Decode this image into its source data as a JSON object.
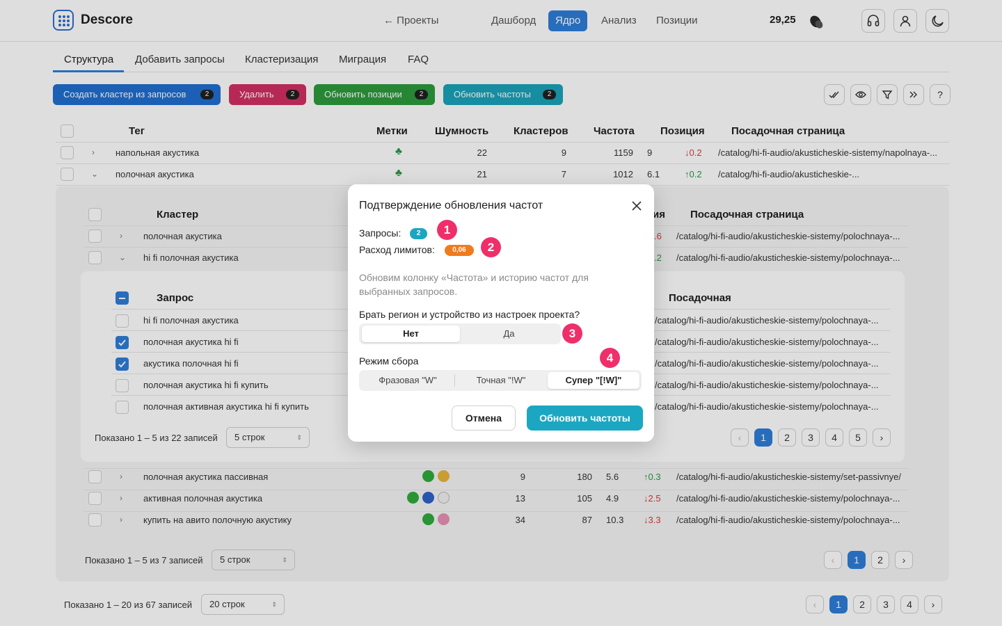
{
  "header": {
    "brand": "Descore",
    "back_label": "← Проекты",
    "nav": [
      "Дашборд",
      "Ядро",
      "Анализ",
      "Позиции"
    ],
    "active_nav": "Ядро",
    "balance": "29,25"
  },
  "tabs": [
    "Структура",
    "Добавить запросы",
    "Кластеризация",
    "Миграция",
    "FAQ"
  ],
  "actions": [
    {
      "label": "Создать кластер из запросов",
      "count": "2",
      "color": "#1f6fd0"
    },
    {
      "label": "Удалить",
      "count": "2",
      "color": "#d22f62"
    },
    {
      "label": "Обновить позиции",
      "count": "2",
      "color": "#2c9a3c"
    },
    {
      "label": "Обновить частоты",
      "count": "2",
      "color": "#1aa3b8"
    }
  ],
  "main_table": {
    "headers": [
      "Тег",
      "Метки",
      "Шумность",
      "Кластеров",
      "Частота",
      "Позиция",
      "Посадочная страница"
    ],
    "rows": [
      {
        "tag": "напольная акустика",
        "noise": "22",
        "clusters": "9",
        "freq": "1159",
        "pos": "9",
        "delta": "↓0.2",
        "url": "/catalog/hi-fi-audio/akusticheskie-sistemy/napolnaya-..."
      },
      {
        "tag": "полочная акустика",
        "noise": "21",
        "clusters": "7",
        "freq": "1012",
        "pos": "6.1",
        "delta": "↑0.2",
        "url": "/catalog/hi-fi-audio/akusticheskie-..."
      }
    ]
  },
  "cluster_table": {
    "headers": [
      "Кластер",
      "Посадочная страница"
    ],
    "header_pos_partial": "ия",
    "rows_top": [
      {
        "name": "полочная акустика",
        "delta": ".6",
        "url": "/catalog/hi-fi-audio/akusticheskie-sistemy/polochnaya-..."
      },
      {
        "name": "hi fi полочная акустика",
        "delta": ".2",
        "url": "/catalog/hi-fi-audio/akusticheskie-sistemy/polochnaya-..."
      }
    ],
    "rows_bottom": [
      {
        "name": "полочная акустика пассивная",
        "noise": "9",
        "freq": "180",
        "pos": "5.6",
        "delta": "↑0.3",
        "url": "/catalog/hi-fi-audio/akusticheskie-sistemy/set-passivnye/"
      },
      {
        "name": "активная полочная акустика",
        "noise": "13",
        "freq": "105",
        "pos": "4.9",
        "delta": "↓2.5",
        "url": "/catalog/hi-fi-audio/akusticheskie-sistemy/polochnaya-..."
      },
      {
        "name": "купить на авито полочную акустику",
        "noise": "34",
        "freq": "87",
        "pos": "10.3",
        "delta": "↓3.3",
        "url": "/catalog/hi-fi-audio/akusticheskie-sistemy/polochnaya-..."
      }
    ],
    "shown": "Показано 1 – 5 из 7 записей",
    "rows_select": "5 строк",
    "pages": [
      "1",
      "2"
    ]
  },
  "query_table": {
    "headers": [
      "Запрос",
      "Посадочная"
    ],
    "rows": [
      {
        "query": "hi fi полочная акустика",
        "checked": false,
        "url": "/catalog/hi-fi-audio/akusticheskie-sistemy/polochnaya-..."
      },
      {
        "query": "полочная акустика hi fi",
        "checked": true,
        "url": "/catalog/hi-fi-audio/akusticheskie-sistemy/polochnaya-..."
      },
      {
        "query": "акустика полочная hi fi",
        "checked": true,
        "url": "/catalog/hi-fi-audio/akusticheskie-sistemy/polochnaya-..."
      },
      {
        "query": "полочная акустика hi fi купить",
        "checked": false,
        "url": "/catalog/hi-fi-audio/akusticheskie-sistemy/polochnaya-..."
      },
      {
        "query": "полочная активная акустика hi fi купить",
        "checked": false,
        "url": "/catalog/hi-fi-audio/akusticheskie-sistemy/polochnaya-..."
      }
    ],
    "shown": "Показано 1 – 5 из 22 записей",
    "rows_select": "5 строк",
    "pages": [
      "1",
      "2",
      "3",
      "4",
      "5"
    ]
  },
  "footer": {
    "shown": "Показано 1 – 20 из 67 записей",
    "rows_select": "20 строк",
    "pages": [
      "1",
      "2",
      "3",
      "4"
    ]
  },
  "modal": {
    "title": "Подтверждение обновления частот",
    "queries_label": "Запросы:",
    "queries_count": "2",
    "limits_label": "Расход лимитов:",
    "limits_value": "0,06",
    "description": "Обновим колонку «Частота» и историю частот для выбранных запросов.",
    "region_question": "Брать регион и устройство из настроек проекта?",
    "region_options": [
      "Нет",
      "Да"
    ],
    "region_selected": "Нет",
    "mode_label": "Режим сбора",
    "mode_options": [
      "Фразовая \"W\"",
      "Точная \"!W\"",
      "Супер \"[!W]\""
    ],
    "mode_selected": "Супер \"[!W]\"",
    "cancel": "Отмена",
    "confirm": "Обновить частоты",
    "markers": [
      "1",
      "2",
      "3",
      "4"
    ]
  },
  "colors": {
    "accent": "#2f7ed8",
    "teal": "#1ba7c2",
    "marker": "#ef2f6a",
    "orange": "#f07b1d"
  }
}
